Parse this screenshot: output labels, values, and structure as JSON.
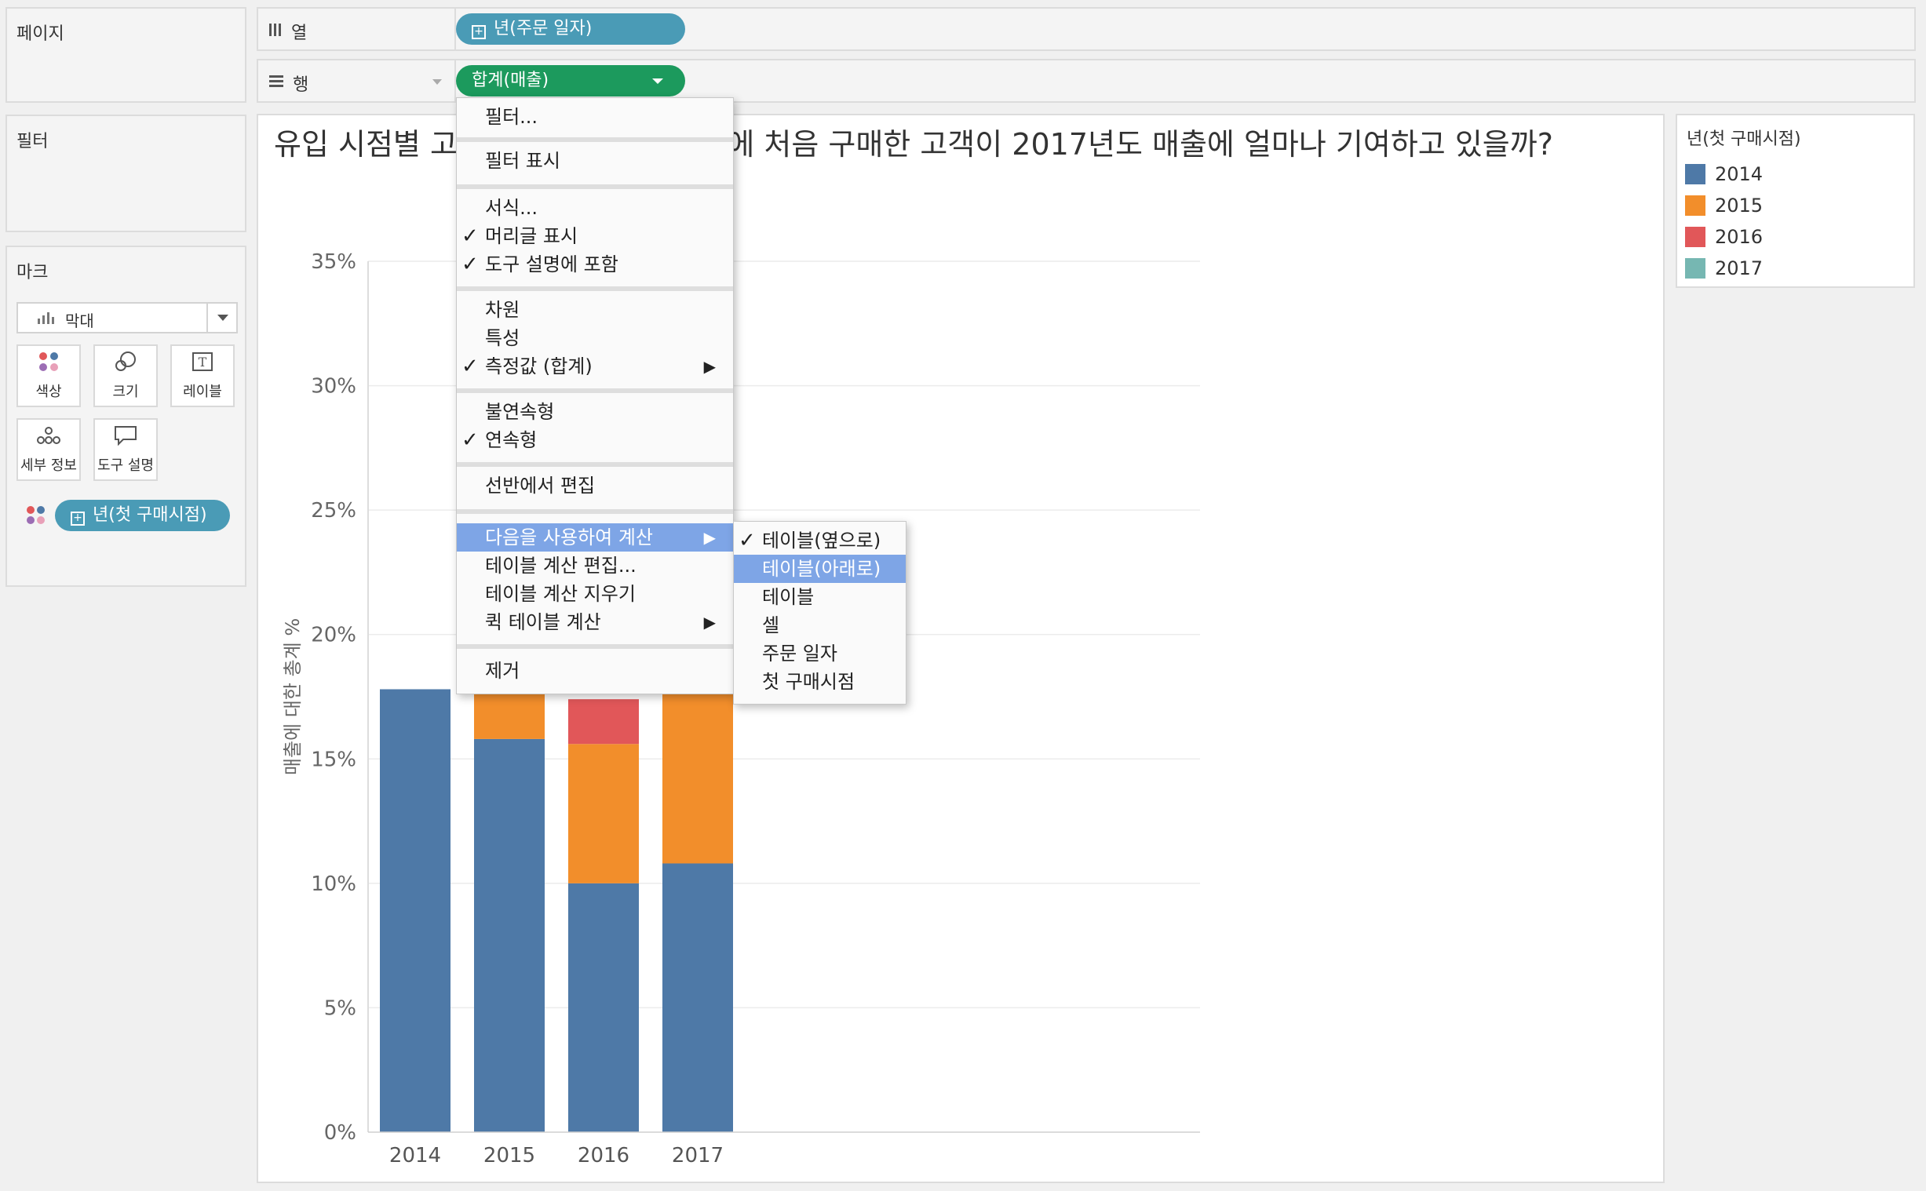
{
  "pages_panel": {
    "title": "페이지"
  },
  "filters_panel": {
    "title": "필터"
  },
  "marks_panel": {
    "title": "마크",
    "type_select": {
      "value": "막대",
      "icon": "bar-chart-icon"
    },
    "cards": [
      {
        "label": "색상",
        "icon": "color-dots-icon"
      },
      {
        "label": "크기",
        "icon": "size-circles-icon"
      },
      {
        "label": "레이블",
        "icon": "text-label-icon"
      },
      {
        "label": "세부 정보",
        "icon": "detail-dots-icon"
      },
      {
        "label": "도구 설명",
        "icon": "tooltip-bubble-icon"
      }
    ],
    "color_pill": "년(첫 구매시점)"
  },
  "columns_shelf": {
    "label": "열",
    "pill": "년(주문 일자)"
  },
  "rows_shelf": {
    "label": "행",
    "pill": "합계(매출)"
  },
  "view": {
    "title": "유입 시점별 고객 기여도: 2014년도에 처음 구매한 고객이 2017년도 매출에 얼마나 기여하고 있을까?"
  },
  "legend": {
    "title": "년(첫 구매시점)",
    "items": [
      {
        "label": "2014",
        "color": "#4e79a7"
      },
      {
        "label": "2015",
        "color": "#f28e2b"
      },
      {
        "label": "2016",
        "color": "#e15759"
      },
      {
        "label": "2017",
        "color": "#76b7b2"
      }
    ]
  },
  "context_menu": {
    "items": [
      {
        "label": "필터...",
        "checked": false
      },
      {
        "label": "필터 표시",
        "checked": false
      },
      {
        "label": "서식...",
        "checked": false
      },
      {
        "label": "머리글 표시",
        "checked": true
      },
      {
        "label": "도구 설명에 포함",
        "checked": true
      },
      {
        "label": "차원",
        "checked": false
      },
      {
        "label": "특성",
        "checked": false
      },
      {
        "label": "측정값 (합계)",
        "checked": true,
        "submenu": true
      },
      {
        "label": "불연속형",
        "checked": false
      },
      {
        "label": "연속형",
        "checked": true
      },
      {
        "label": "선반에서 편집",
        "checked": false
      },
      {
        "label": "다음을 사용하여 계산",
        "checked": false,
        "submenu": true,
        "highlighted": true
      },
      {
        "label": "테이블 계산 편집...",
        "checked": false
      },
      {
        "label": "테이블 계산 지우기",
        "checked": false
      },
      {
        "label": "퀵 테이블 계산",
        "checked": false,
        "submenu": true
      },
      {
        "label": "제거",
        "checked": false
      }
    ]
  },
  "submenu": {
    "items": [
      {
        "label": "테이블(옆으로)",
        "checked": true
      },
      {
        "label": "테이블(아래로)",
        "checked": false,
        "highlighted": true
      },
      {
        "label": "테이블",
        "checked": false
      },
      {
        "label": "셀",
        "checked": false
      },
      {
        "label": "주문 일자",
        "checked": false
      },
      {
        "label": "첫 구매시점",
        "checked": false
      }
    ]
  },
  "chart_data": {
    "type": "bar",
    "stacked": true,
    "categories": [
      "2014",
      "2015",
      "2016",
      "2017"
    ],
    "series": [
      {
        "name": "2014",
        "color": "#4e79a7",
        "values": [
          17.8,
          15.8,
          10.0,
          10.8
        ]
      },
      {
        "name": "2015",
        "color": "#f28e2b",
        "values": [
          0,
          5.6,
          5.6,
          6.8
        ]
      },
      {
        "name": "2016",
        "color": "#e15759",
        "values": [
          0,
          0,
          1.8,
          1.8
        ]
      },
      {
        "name": "2017",
        "color": "#76b7b2",
        "values": [
          0,
          0,
          0,
          0.1
        ]
      }
    ],
    "ylabel": "매출에 대한 총계 %",
    "ylim": [
      0,
      35
    ],
    "yticks": [
      "0%",
      "5%",
      "10%",
      "15%",
      "20%",
      "25%",
      "30%",
      "35%"
    ],
    "grid": true
  }
}
